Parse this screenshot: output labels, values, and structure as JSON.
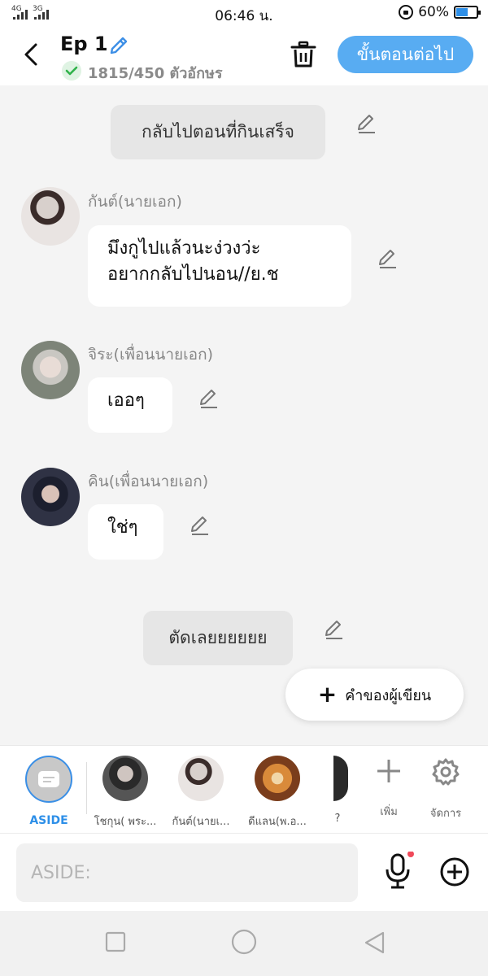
{
  "status_bar": {
    "network_1": "4G",
    "network_2": "3G",
    "time": "06:46 น.",
    "battery_percent": "60%",
    "battery_level": 0.6,
    "icons": [
      "signal-icon",
      "rotation-lock-icon",
      "battery-icon"
    ]
  },
  "header": {
    "episode_title": "Ep 1",
    "char_count": "1815/450 ตัวอักษร",
    "next_button": "ขั้นตอนต่อไป",
    "accent_color": "#58acf2",
    "icons": [
      "back-icon",
      "edit-pencil-icon",
      "check-icon",
      "trash-icon"
    ]
  },
  "chat": {
    "narration_1": "กลับไปตอนที่กินเสร็จ",
    "messages": [
      {
        "name": "กันต์(นายเอก)",
        "line1": "มึงกูไปแล้วนะง่วงว่ะ",
        "line2": "อยากกลับไปนอน//ย.ช"
      },
      {
        "name": "จิระ(เพื่อนนายเอก)",
        "line1": "เออๆ"
      },
      {
        "name": "คิน(เพื่อนนายเอก)",
        "line1": "ใช่ๆ"
      }
    ],
    "narration_2": "ตัดเลยยยยยย",
    "add_author_note": "คำของผู้เขียน"
  },
  "character_bar": {
    "aside_label": "ASIDE",
    "characters": [
      {
        "label": "โชกุน( พระ..."
      },
      {
        "label": "กันต์(นายเ..."
      },
      {
        "label": "ดีแลน(พ.อ..."
      },
      {
        "label": "?"
      }
    ],
    "add_label": "เพิ่ม",
    "manage_label": "จัดการ"
  },
  "input": {
    "placeholder": "ASIDE:",
    "icons": [
      "microphone-icon",
      "add-circle-icon"
    ]
  },
  "nav": {
    "icons": [
      "recent-apps-icon",
      "home-icon",
      "back-triangle-icon"
    ]
  }
}
